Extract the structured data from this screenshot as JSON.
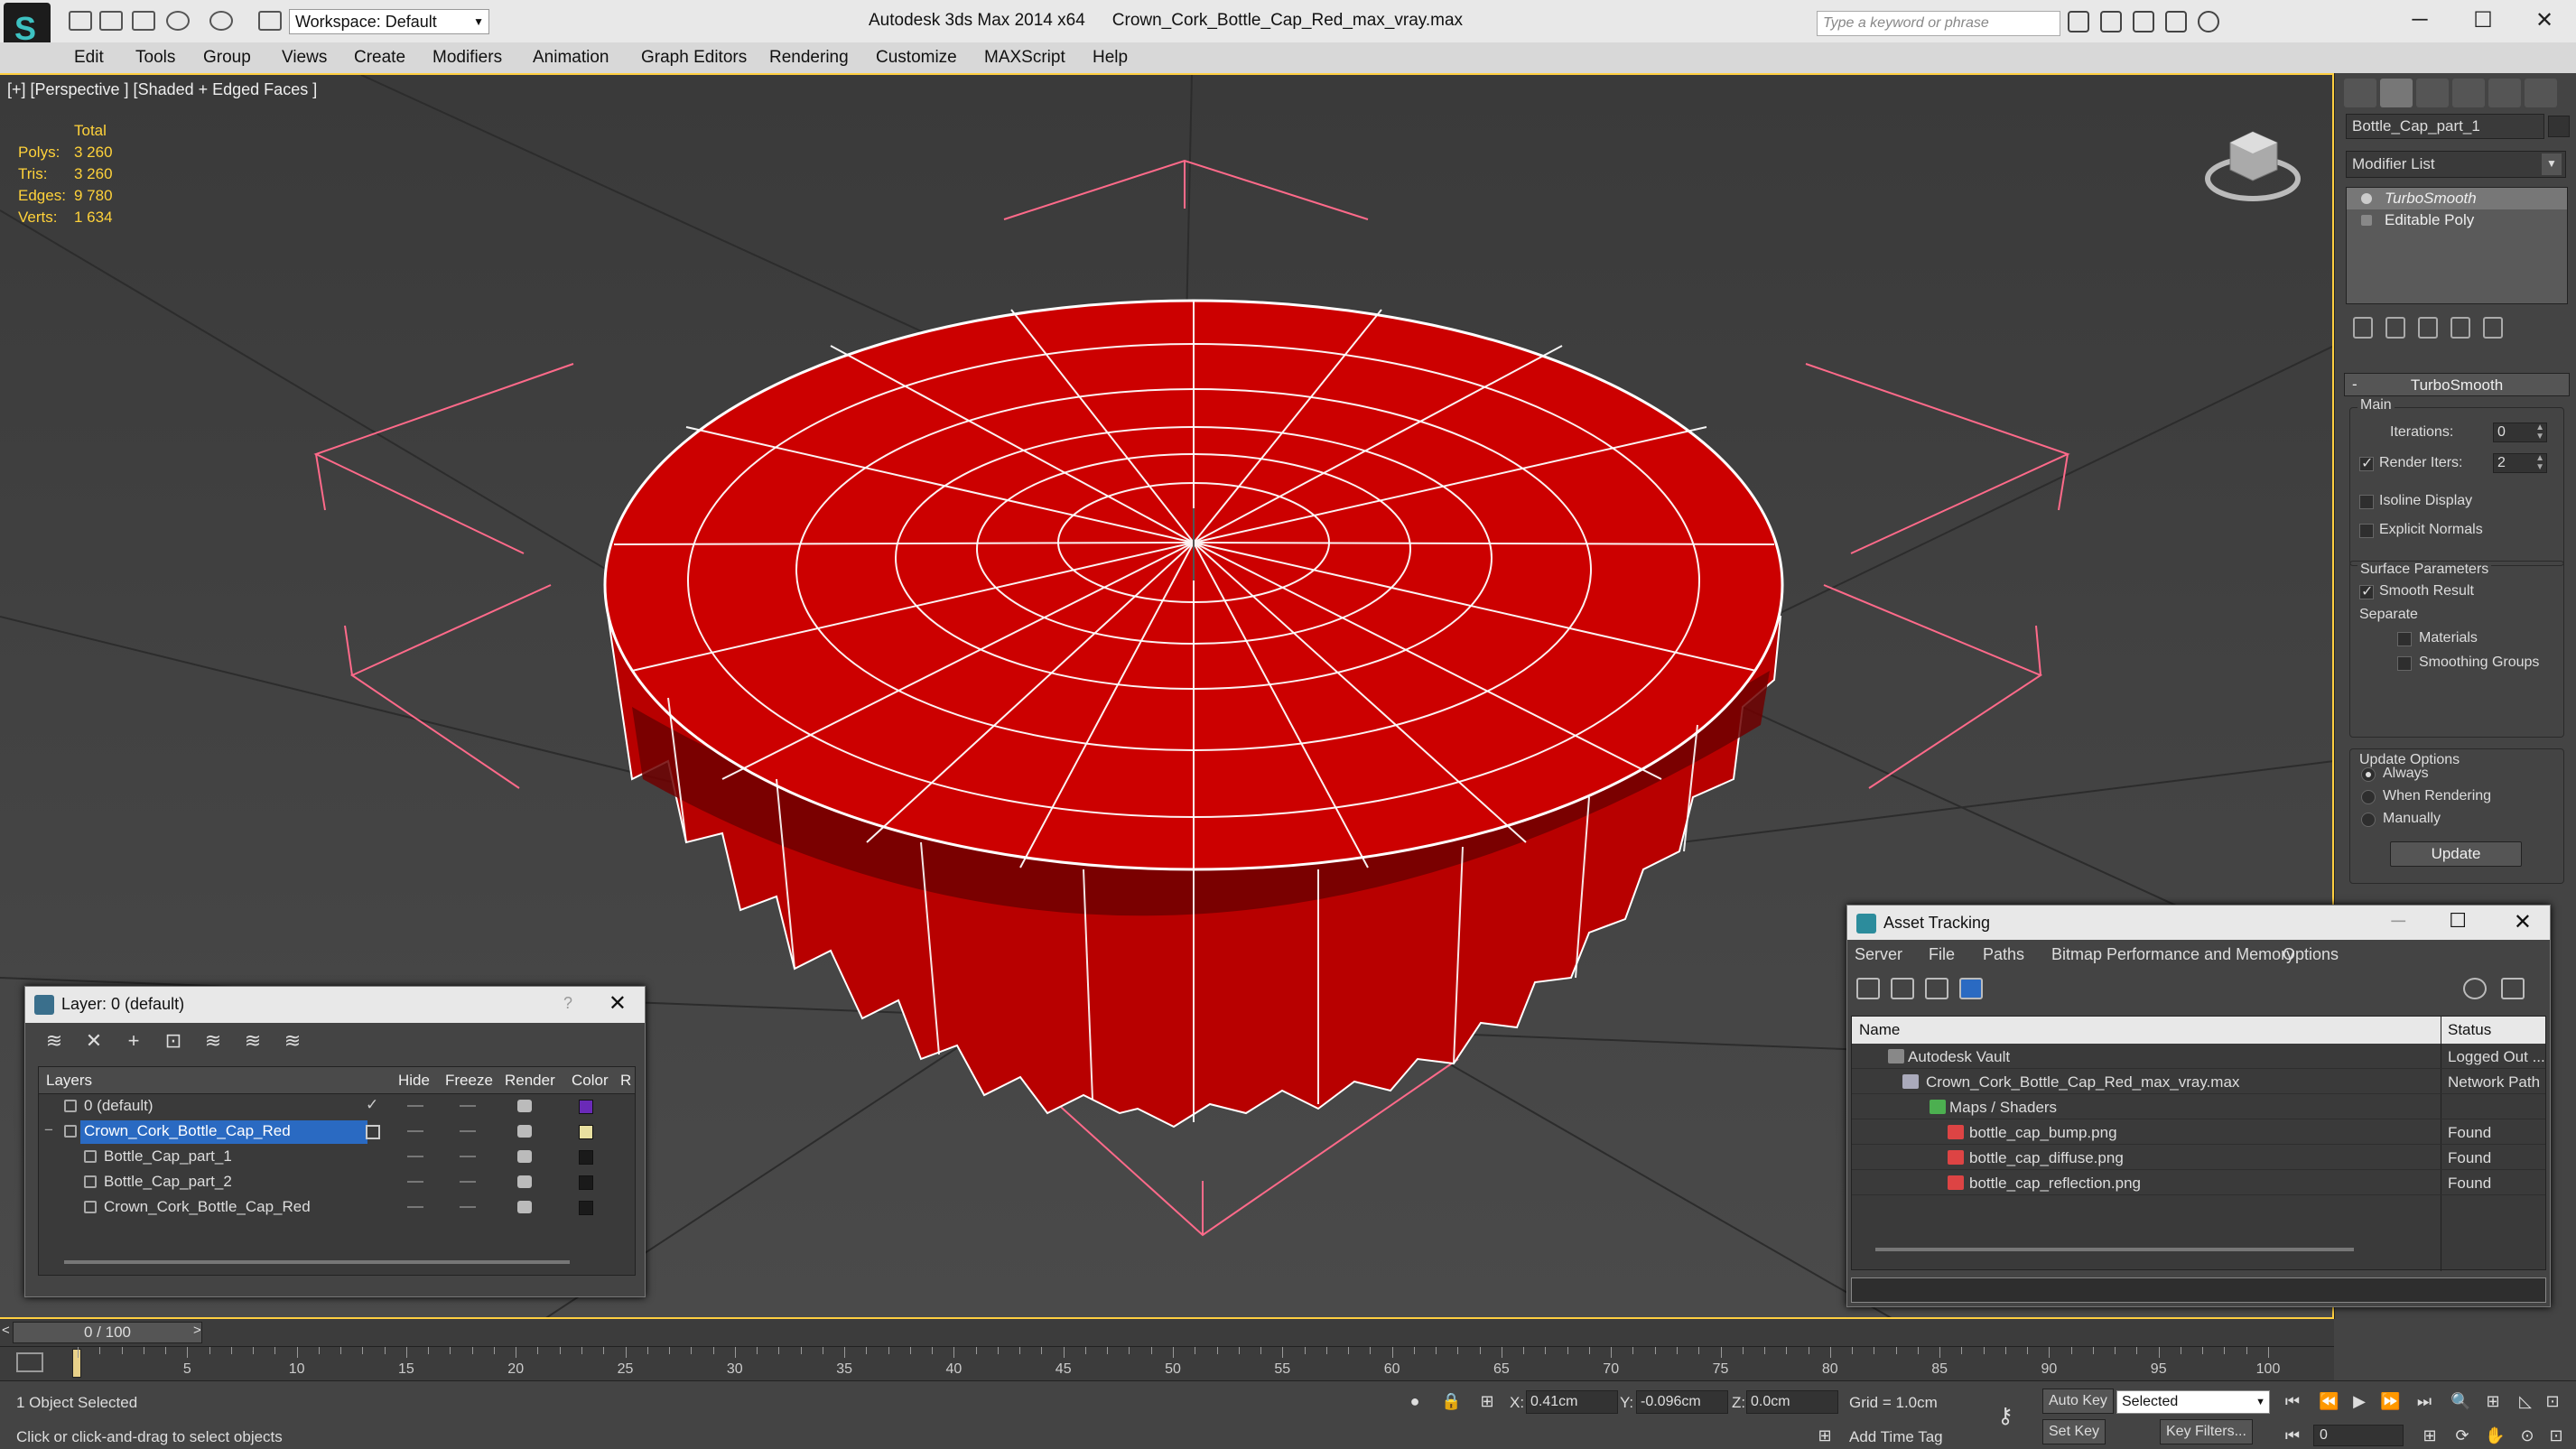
{
  "titlebar": {
    "app_title": "Autodesk 3ds Max  2014 x64",
    "file_name": "Crown_Cork_Bottle_Cap_Red_max_vray.max",
    "workspace": "Workspace: Default",
    "search_placeholder": "Type a keyword or phrase"
  },
  "menu": [
    "Edit",
    "Tools",
    "Group",
    "Views",
    "Create",
    "Modifiers",
    "Animation",
    "Graph Editors",
    "Rendering",
    "Customize",
    "MAXScript",
    "Help"
  ],
  "viewport": {
    "label": "[+] [Perspective ] [Shaded + Edged Faces ]",
    "stats": {
      "total_label": "Total",
      "rows": [
        {
          "k": "Polys:",
          "v": "3 260"
        },
        {
          "k": "Tris:",
          "v": "3 260"
        },
        {
          "k": "Edges:",
          "v": "9 780"
        },
        {
          "k": "Verts:",
          "v": "1 634"
        }
      ]
    },
    "object_color": "#cc0000"
  },
  "cmd": {
    "object_name": "Bottle_Cap_part_1",
    "modifier_list": "Modifier List",
    "stack": [
      "TurboSmooth",
      "Editable Poly"
    ],
    "rollout": "TurboSmooth",
    "main": "Main",
    "iterations_label": "Iterations:",
    "iterations": "0",
    "render_iters_label": "Render Iters:",
    "render_iters": "2",
    "isoline": "Isoline Display",
    "explicit": "Explicit Normals",
    "surface": "Surface Parameters",
    "smooth_result": "Smooth Result",
    "separate": "Separate",
    "materials": "Materials",
    "smoothing_groups": "Smoothing Groups",
    "update_options": "Update Options",
    "always": "Always",
    "when_rendering": "When Rendering",
    "manually": "Manually",
    "update_btn": "Update"
  },
  "layer": {
    "title": "Layer: 0 (default)",
    "help": "?",
    "headers": {
      "layers": "Layers",
      "hide": "Hide",
      "freeze": "Freeze",
      "render": "Render",
      "color": "Color",
      "r": "R"
    },
    "rows": [
      {
        "name": "0 (default)",
        "color": "#6a2ab8"
      },
      {
        "name": "Crown_Cork_Bottle_Cap_Red",
        "color": "#e8e0a0"
      },
      {
        "name": "Bottle_Cap_part_1",
        "color": "#1a1a1a"
      },
      {
        "name": "Bottle_Cap_part_2",
        "color": "#1a1a1a"
      },
      {
        "name": "Crown_Cork_Bottle_Cap_Red",
        "color": "#1a1a1a"
      }
    ]
  },
  "asset": {
    "title": "Asset Tracking",
    "menu": [
      "Server",
      "File",
      "Paths",
      "Bitmap Performance and Memory",
      "Options"
    ],
    "headers": {
      "name": "Name",
      "status": "Status"
    },
    "rows": [
      {
        "name": "Autodesk Vault",
        "status": "Logged Out ..."
      },
      {
        "name": "Crown_Cork_Bottle_Cap_Red_max_vray.max",
        "status": "Network Path"
      },
      {
        "name": "Maps / Shaders",
        "status": ""
      },
      {
        "name": "bottle_cap_bump.png",
        "status": "Found"
      },
      {
        "name": "bottle_cap_diffuse.png",
        "status": "Found"
      },
      {
        "name": "bottle_cap_reflection.png",
        "status": "Found"
      }
    ]
  },
  "timeline": {
    "slider": "0 / 100",
    "ticks": [
      "5",
      "10",
      "15",
      "20",
      "25",
      "30",
      "35",
      "40",
      "45",
      "50",
      "55",
      "60",
      "65",
      "70",
      "75",
      "80",
      "85",
      "90",
      "95",
      "100"
    ]
  },
  "status": {
    "selection": "1 Object Selected",
    "prompt": "Click or click-and-drag to select objects",
    "x_label": "X:",
    "x": "0.41cm",
    "y_label": "Y:",
    "y": "-0.096cm",
    "z_label": "Z:",
    "z": "0.0cm",
    "grid": "Grid = 1.0cm",
    "add_time_tag": "Add Time Tag",
    "auto_key": "Auto Key",
    "set_key": "Set Key",
    "selected": "Selected",
    "key_filters": "Key Filters...",
    "frame": "0"
  }
}
